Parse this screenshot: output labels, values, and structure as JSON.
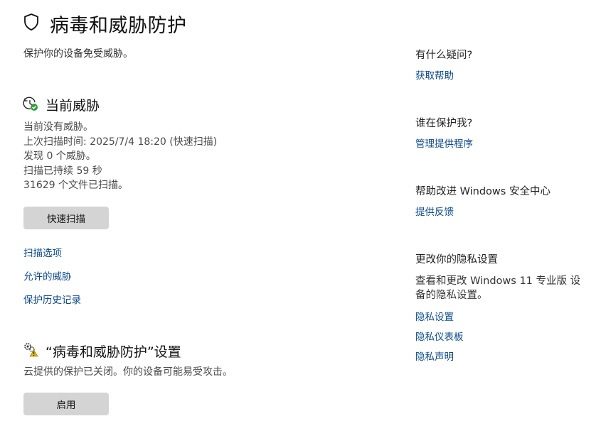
{
  "header": {
    "title": "病毒和威胁防护",
    "subtitle": "保护你的设备免受威胁。",
    "icon": "shield-icon"
  },
  "current_threats": {
    "title": "当前威胁",
    "icon": "clock-check-icon",
    "status": "当前没有威胁。",
    "last_scan": "上次扫描时间: 2025/7/4 18:20 (快速扫描)",
    "found": "发现 0 个威胁。",
    "duration": "扫描已持续 59 秒",
    "files": "31629 个文件已扫描。",
    "quick_scan_label": "快速扫描",
    "links": [
      "扫描选项",
      "允许的威胁",
      "保护历史记录"
    ]
  },
  "settings": {
    "title": "“病毒和威胁防护”设置",
    "icon": "gears-warning-icon",
    "description": "云提供的保护已关闭。你的设备可能易受攻击。",
    "enable_label": "启用"
  },
  "sidebar": {
    "help": {
      "heading": "有什么疑问?",
      "link": "获取帮助"
    },
    "who": {
      "heading": "谁在保护我?",
      "link": "管理提供程序"
    },
    "improve": {
      "heading": "帮助改进 Windows 安全中心",
      "link": "提供反馈"
    },
    "privacy": {
      "heading": "更改你的隐私设置",
      "text": "查看和更改 Windows 11 专业版 设备的隐私设置。",
      "links": [
        "隐私设置",
        "隐私仪表板",
        "隐私声明"
      ]
    }
  },
  "colors": {
    "link": "#0b4a8c",
    "button": "#d4d4d4",
    "check": "#2e9e3e",
    "warning": "#e8b400"
  }
}
